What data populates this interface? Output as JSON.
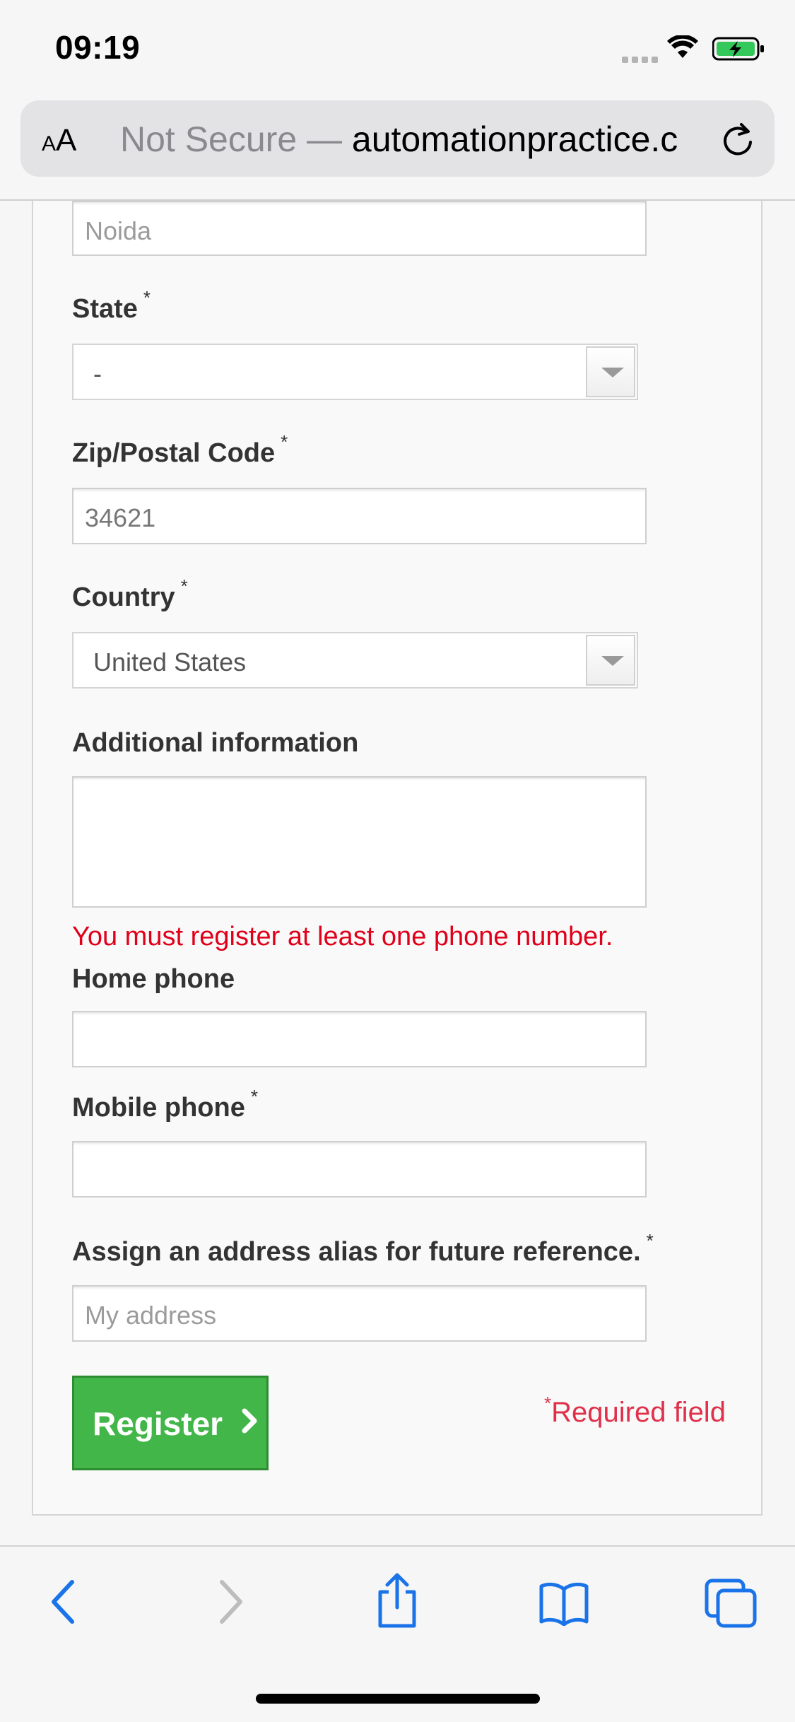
{
  "status_bar": {
    "time": "09:19"
  },
  "browser": {
    "text_size_label_small": "A",
    "text_size_label_large": "A",
    "security_text": "Not Secure —",
    "domain_text": "automationpractice.c"
  },
  "form": {
    "city_value": "Noida",
    "state_label": "State",
    "state_required": "*",
    "state_value": "-",
    "zip_label": "Zip/Postal Code",
    "zip_required": "*",
    "zip_value": "34621",
    "country_label": "Country",
    "country_required": "*",
    "country_value": "United States",
    "additional_label": "Additional information",
    "phone_error": "You must register at least one phone number.",
    "home_phone_label": "Home phone",
    "mobile_phone_label": "Mobile phone",
    "mobile_phone_required": "*",
    "alias_label": "Assign an address alias for future reference.",
    "alias_required": "*",
    "alias_value": "My address",
    "register_label": "Register",
    "required_star": "*",
    "required_text": "Required field"
  },
  "colors": {
    "register_green": "#43b649",
    "error_red": "#e0001a"
  }
}
